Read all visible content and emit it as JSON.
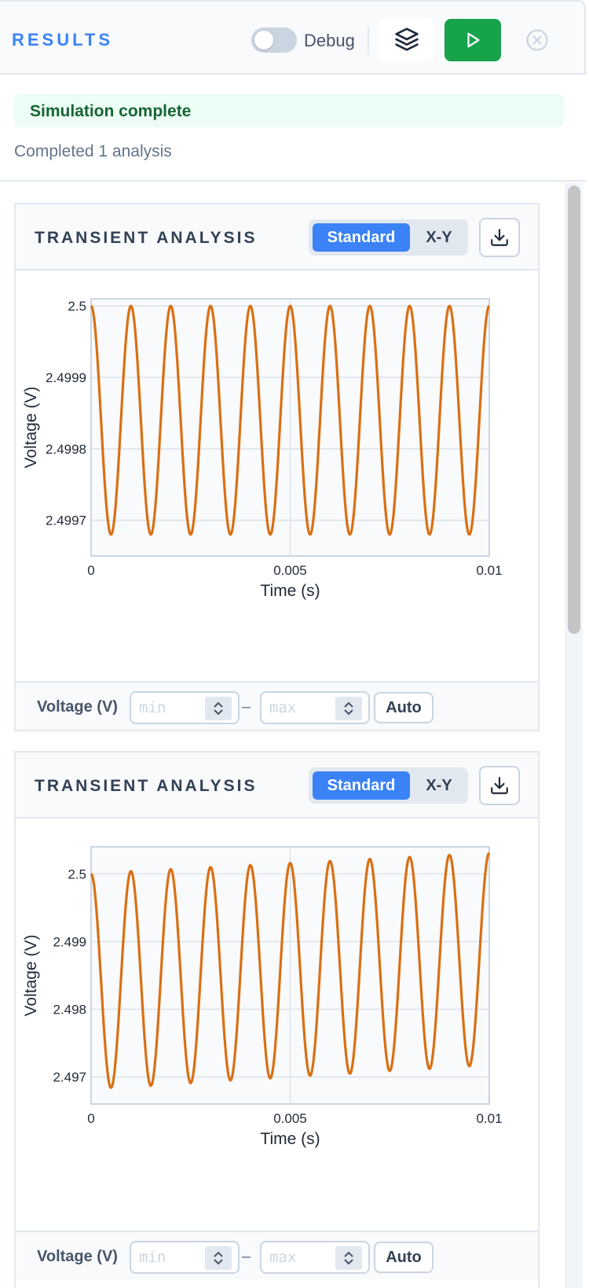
{
  "header": {
    "title": "RESULTS",
    "debug_label": "Debug",
    "debug_enabled": false,
    "icons": {
      "layers": "layers-icon",
      "run": "play-icon",
      "close": "close-circle-icon"
    }
  },
  "status": {
    "banner": "Simulation complete",
    "summary": "Completed 1 analysis"
  },
  "colors": {
    "accent": "#3b82f6",
    "run": "#16a34a",
    "trace": "#d97014",
    "status_bg": "#ecfdf5"
  },
  "cards": [
    {
      "title": "TRANSIENT ANALYSIS",
      "mode_standard": "Standard",
      "mode_xy": "X-Y",
      "active_mode": "Standard",
      "footer": {
        "label": "Voltage (V)",
        "min_placeholder": "min",
        "max_placeholder": "max",
        "dash": "–",
        "auto_label": "Auto"
      }
    },
    {
      "title": "TRANSIENT ANALYSIS",
      "mode_standard": "Standard",
      "mode_xy": "X-Y",
      "active_mode": "Standard",
      "footer": {
        "label": "Voltage (V)",
        "min_placeholder": "min",
        "max_placeholder": "max",
        "dash": "–",
        "auto_label": "Auto"
      }
    }
  ],
  "chart_data": [
    {
      "type": "line",
      "xlabel": "Time (s)",
      "ylabel": "Voltage (V)",
      "xlim": [
        0,
        0.01
      ],
      "ylim": [
        2.49965,
        2.50001
      ],
      "x_ticks": [
        0,
        0.005,
        0.01
      ],
      "x_tick_labels": [
        "0",
        "0.005",
        "0.01"
      ],
      "y_ticks": [
        2.5,
        2.4999,
        2.4998,
        2.4997
      ],
      "y_tick_labels": [
        "2.5",
        "2.4999",
        "2.4998",
        "2.4997"
      ],
      "grid": true,
      "series": [
        {
          "frequency_hz": 1000,
          "x": [
            0,
            0.0005,
            0.001,
            0.0015,
            0.002,
            0.0025,
            0.003,
            0.0035,
            0.004,
            0.0045,
            0.005,
            0.0055,
            0.006,
            0.0065,
            0.007,
            0.0075,
            0.008,
            0.0085,
            0.009,
            0.0095,
            0.01
          ],
          "y": [
            2.5,
            2.49968,
            2.5,
            2.49968,
            2.5,
            2.49968,
            2.5,
            2.49968,
            2.5,
            2.49968,
            2.5,
            2.49968,
            2.5,
            2.49968,
            2.5,
            2.49968,
            2.5,
            2.49968,
            2.5,
            2.49968,
            2.5
          ]
        }
      ]
    },
    {
      "type": "line",
      "xlabel": "Time (s)",
      "ylabel": "Voltage (V)",
      "xlim": [
        0,
        0.01
      ],
      "ylim": [
        2.4966,
        2.5004
      ],
      "x_ticks": [
        0,
        0.005,
        0.01
      ],
      "x_tick_labels": [
        "0",
        "0.005",
        "0.01"
      ],
      "y_ticks": [
        2.5,
        2.499,
        2.498,
        2.497
      ],
      "y_tick_labels": [
        "2.5",
        "2.499",
        "2.498",
        "2.497"
      ],
      "grid": true,
      "series": [
        {
          "frequency_hz": 1000,
          "x": [
            0,
            0.0005,
            0.001,
            0.0015,
            0.002,
            0.0025,
            0.003,
            0.0035,
            0.004,
            0.0045,
            0.005,
            0.0055,
            0.006,
            0.0065,
            0.007,
            0.0075,
            0.008,
            0.0085,
            0.009,
            0.0095,
            0.01
          ],
          "y": [
            2.5,
            2.49684,
            2.50004,
            2.49687,
            2.50007,
            2.49691,
            2.5001,
            2.49695,
            2.50013,
            2.49698,
            2.50016,
            2.49702,
            2.50019,
            2.49705,
            2.50022,
            2.49709,
            2.50025,
            2.49712,
            2.50028,
            2.49716,
            2.50031
          ]
        }
      ]
    }
  ]
}
